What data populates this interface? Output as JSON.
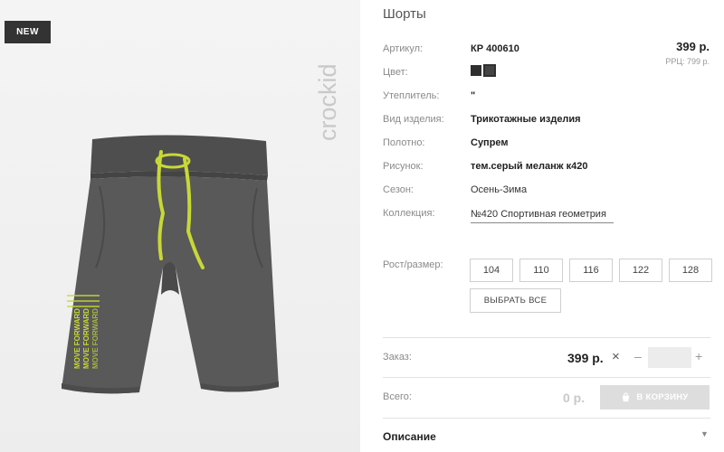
{
  "product": {
    "title": "Шорты",
    "badge": "NEW",
    "brand": "crockid"
  },
  "price": {
    "main": "399 р.",
    "rrp": "РРЦ: 799 р."
  },
  "specs": {
    "article_label": "Артикул:",
    "article_value": "КР 400610",
    "color_label": "Цвет:",
    "insulation_label": "Утеплитель:",
    "insulation_value": "\"",
    "type_label": "Вид изделия:",
    "type_value": "Трикотажные изделия",
    "fabric_label": "Полотно:",
    "fabric_value": "Супрем",
    "pattern_label": "Рисунок:",
    "pattern_value": "тем.серый меланж к420",
    "season_label": "Сезон:",
    "season_value": "Осень-Зима",
    "collection_label": "Коллекция:",
    "collection_value": "№420 Спортивная геометрия"
  },
  "sizes": {
    "label": "Рост/размер:",
    "options": [
      "104",
      "110",
      "116",
      "122",
      "128"
    ],
    "select_all": "ВЫБРАТЬ ВСЕ"
  },
  "order": {
    "label": "Заказ:",
    "price": "399 р.",
    "times": "×",
    "minus": "–",
    "plus": "+",
    "quantity": ""
  },
  "total": {
    "label": "Всего:",
    "value": "0 р.",
    "cart_button": "В КОРЗИНУ"
  },
  "description": {
    "label": "Описание"
  },
  "colors": {
    "swatch": "#2f2f2f",
    "accent_lime": "#c8d836",
    "fabric": "#5a5a5a"
  }
}
